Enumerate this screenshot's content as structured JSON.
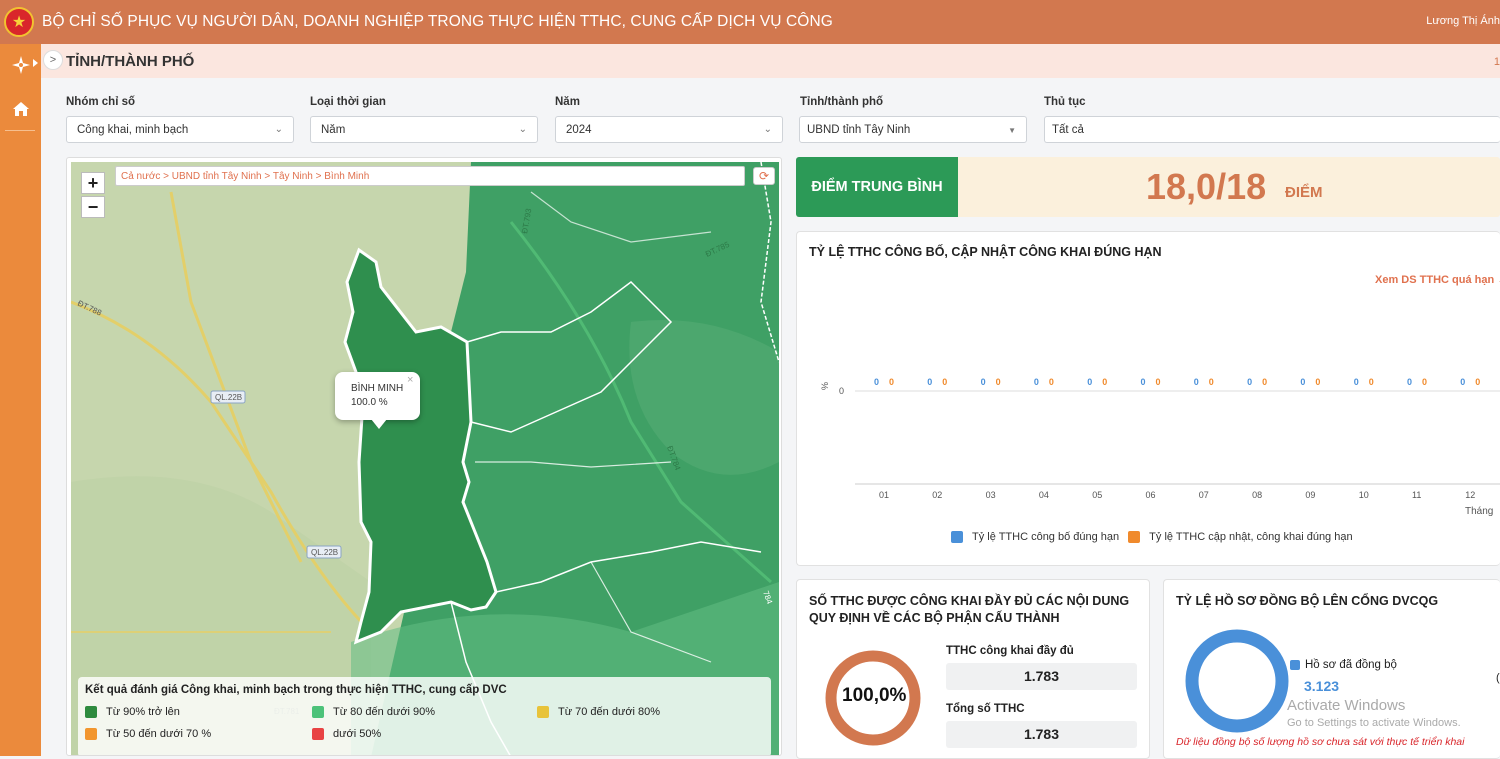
{
  "header": {
    "title": "BỘ CHỈ SỐ PHỤC VỤ NGƯỜI DÂN, DOANH NGHIỆP TRONG THỰC HIỆN TTHC, CUNG CẤP DỊCH VỤ CÔNG",
    "user_name": "Lương Thị Ánh"
  },
  "page": {
    "title": "TỈNH/THÀNH PHỐ",
    "right_num": "1"
  },
  "sidebar": {
    "items": [
      {
        "icon": "compass-icon"
      },
      {
        "icon": "home-icon"
      }
    ]
  },
  "filters": {
    "nhom_chi_so": {
      "label": "Nhóm chỉ số",
      "value": "Công khai, minh bạch"
    },
    "loai_thoi_gian": {
      "label": "Loại thời gian",
      "value": "Năm"
    },
    "nam": {
      "label": "Năm",
      "value": "2024"
    },
    "tinh_thanh_pho": {
      "label": "Tỉnh/thành phố",
      "value": "UBND tỉnh Tây Ninh"
    },
    "thu_tuc": {
      "label": "Thủ tục",
      "value": "Tất cả"
    }
  },
  "map": {
    "zoom_in": "+",
    "zoom_out": "−",
    "breadcrumb": "Cả nước > UBND tỉnh Tây Ninh > Tây Ninh > Bình Minh",
    "popup": {
      "name": "BÌNH MINH",
      "value": "100.0 %",
      "close": "×"
    },
    "road_labels": [
      "ĐT.788",
      "QL.22B",
      "QL.22B",
      "ĐT.793",
      "ĐT.785",
      "ĐT.784",
      "ĐT.781",
      "784"
    ],
    "legend": {
      "title": "Kết quả đánh giá Công khai, minh bạch trong thực hiện TTHC, cung cấp DVC",
      "items": [
        {
          "label": "Từ 90% trở lên",
          "color": "#2e8b3e"
        },
        {
          "label": "Từ 80 đến dưới 90%",
          "color": "#4cc279"
        },
        {
          "label": "Từ 70 đến dưới 80%",
          "color": "#e8c33a"
        },
        {
          "label": "Từ 50 đến dưới 70 %",
          "color": "#f2962e"
        },
        {
          "label": "dưới 50%",
          "color": "#e84343"
        }
      ]
    }
  },
  "score": {
    "label": "ĐIỂM TRUNG BÌNH",
    "value": "18,0/18",
    "unit": "ĐIỂM"
  },
  "chart_card": {
    "title": "TỶ LỆ TTHC CÔNG BỐ, CẬP NHẬT CÔNG KHAI ĐÚNG HẠN",
    "link": "Xem DS TTHC quá hạn →",
    "y_unit": "%",
    "y_tick": "0",
    "x_unit": "Tháng"
  },
  "chart_data": {
    "type": "bar",
    "categories": [
      "01",
      "02",
      "03",
      "04",
      "05",
      "06",
      "07",
      "08",
      "09",
      "10",
      "11",
      "12"
    ],
    "series": [
      {
        "name": "Tỷ lệ TTHC công bố đúng hạn",
        "color": "#4a90d9",
        "values": [
          0,
          0,
          0,
          0,
          0,
          0,
          0,
          0,
          0,
          0,
          0,
          0
        ]
      },
      {
        "name": "Tỷ lệ TTHC cập nhật, công khai đúng hạn",
        "color": "#f08a2c",
        "values": [
          0,
          0,
          0,
          0,
          0,
          0,
          0,
          0,
          0,
          0,
          0,
          0
        ]
      }
    ],
    "title": "TỶ LỆ TTHC CÔNG BỐ, CẬP NHẬT CÔNG KHAI ĐÚNG HẠN",
    "xlabel": "Tháng",
    "ylabel": "%",
    "legend": "bottom"
  },
  "cong_khai_card": {
    "title_line1": "SỐ TTHC ĐƯỢC CÔNG KHAI ĐẦY ĐỦ CÁC NỘI DUNG",
    "title_line2": "QUY ĐỊNH VỀ CÁC BỘ PHẬN CẤU THÀNH",
    "percent": "100,0%",
    "full_label": "TTHC công khai đầy đủ",
    "full_value": "1.783",
    "total_label": "Tổng số TTHC",
    "total_value": "1.783",
    "ring_color": "#d2784f"
  },
  "dong_bo_card": {
    "title": "TỶ LỆ HỒ SƠ ĐỒNG BỘ LÊN CỔNG DVCQG",
    "synced_label": "Hồ sơ đã đồng bộ",
    "synced_value": "3.123",
    "note": "Dữ liệu đồng bộ số lượng hồ sơ chưa sát với thực tế triển khai",
    "ring_color": "#4a90d9",
    "cut_char": "("
  },
  "watermark": {
    "line1": "Activate Windows",
    "line2": "Go to Settings to activate Windows."
  }
}
